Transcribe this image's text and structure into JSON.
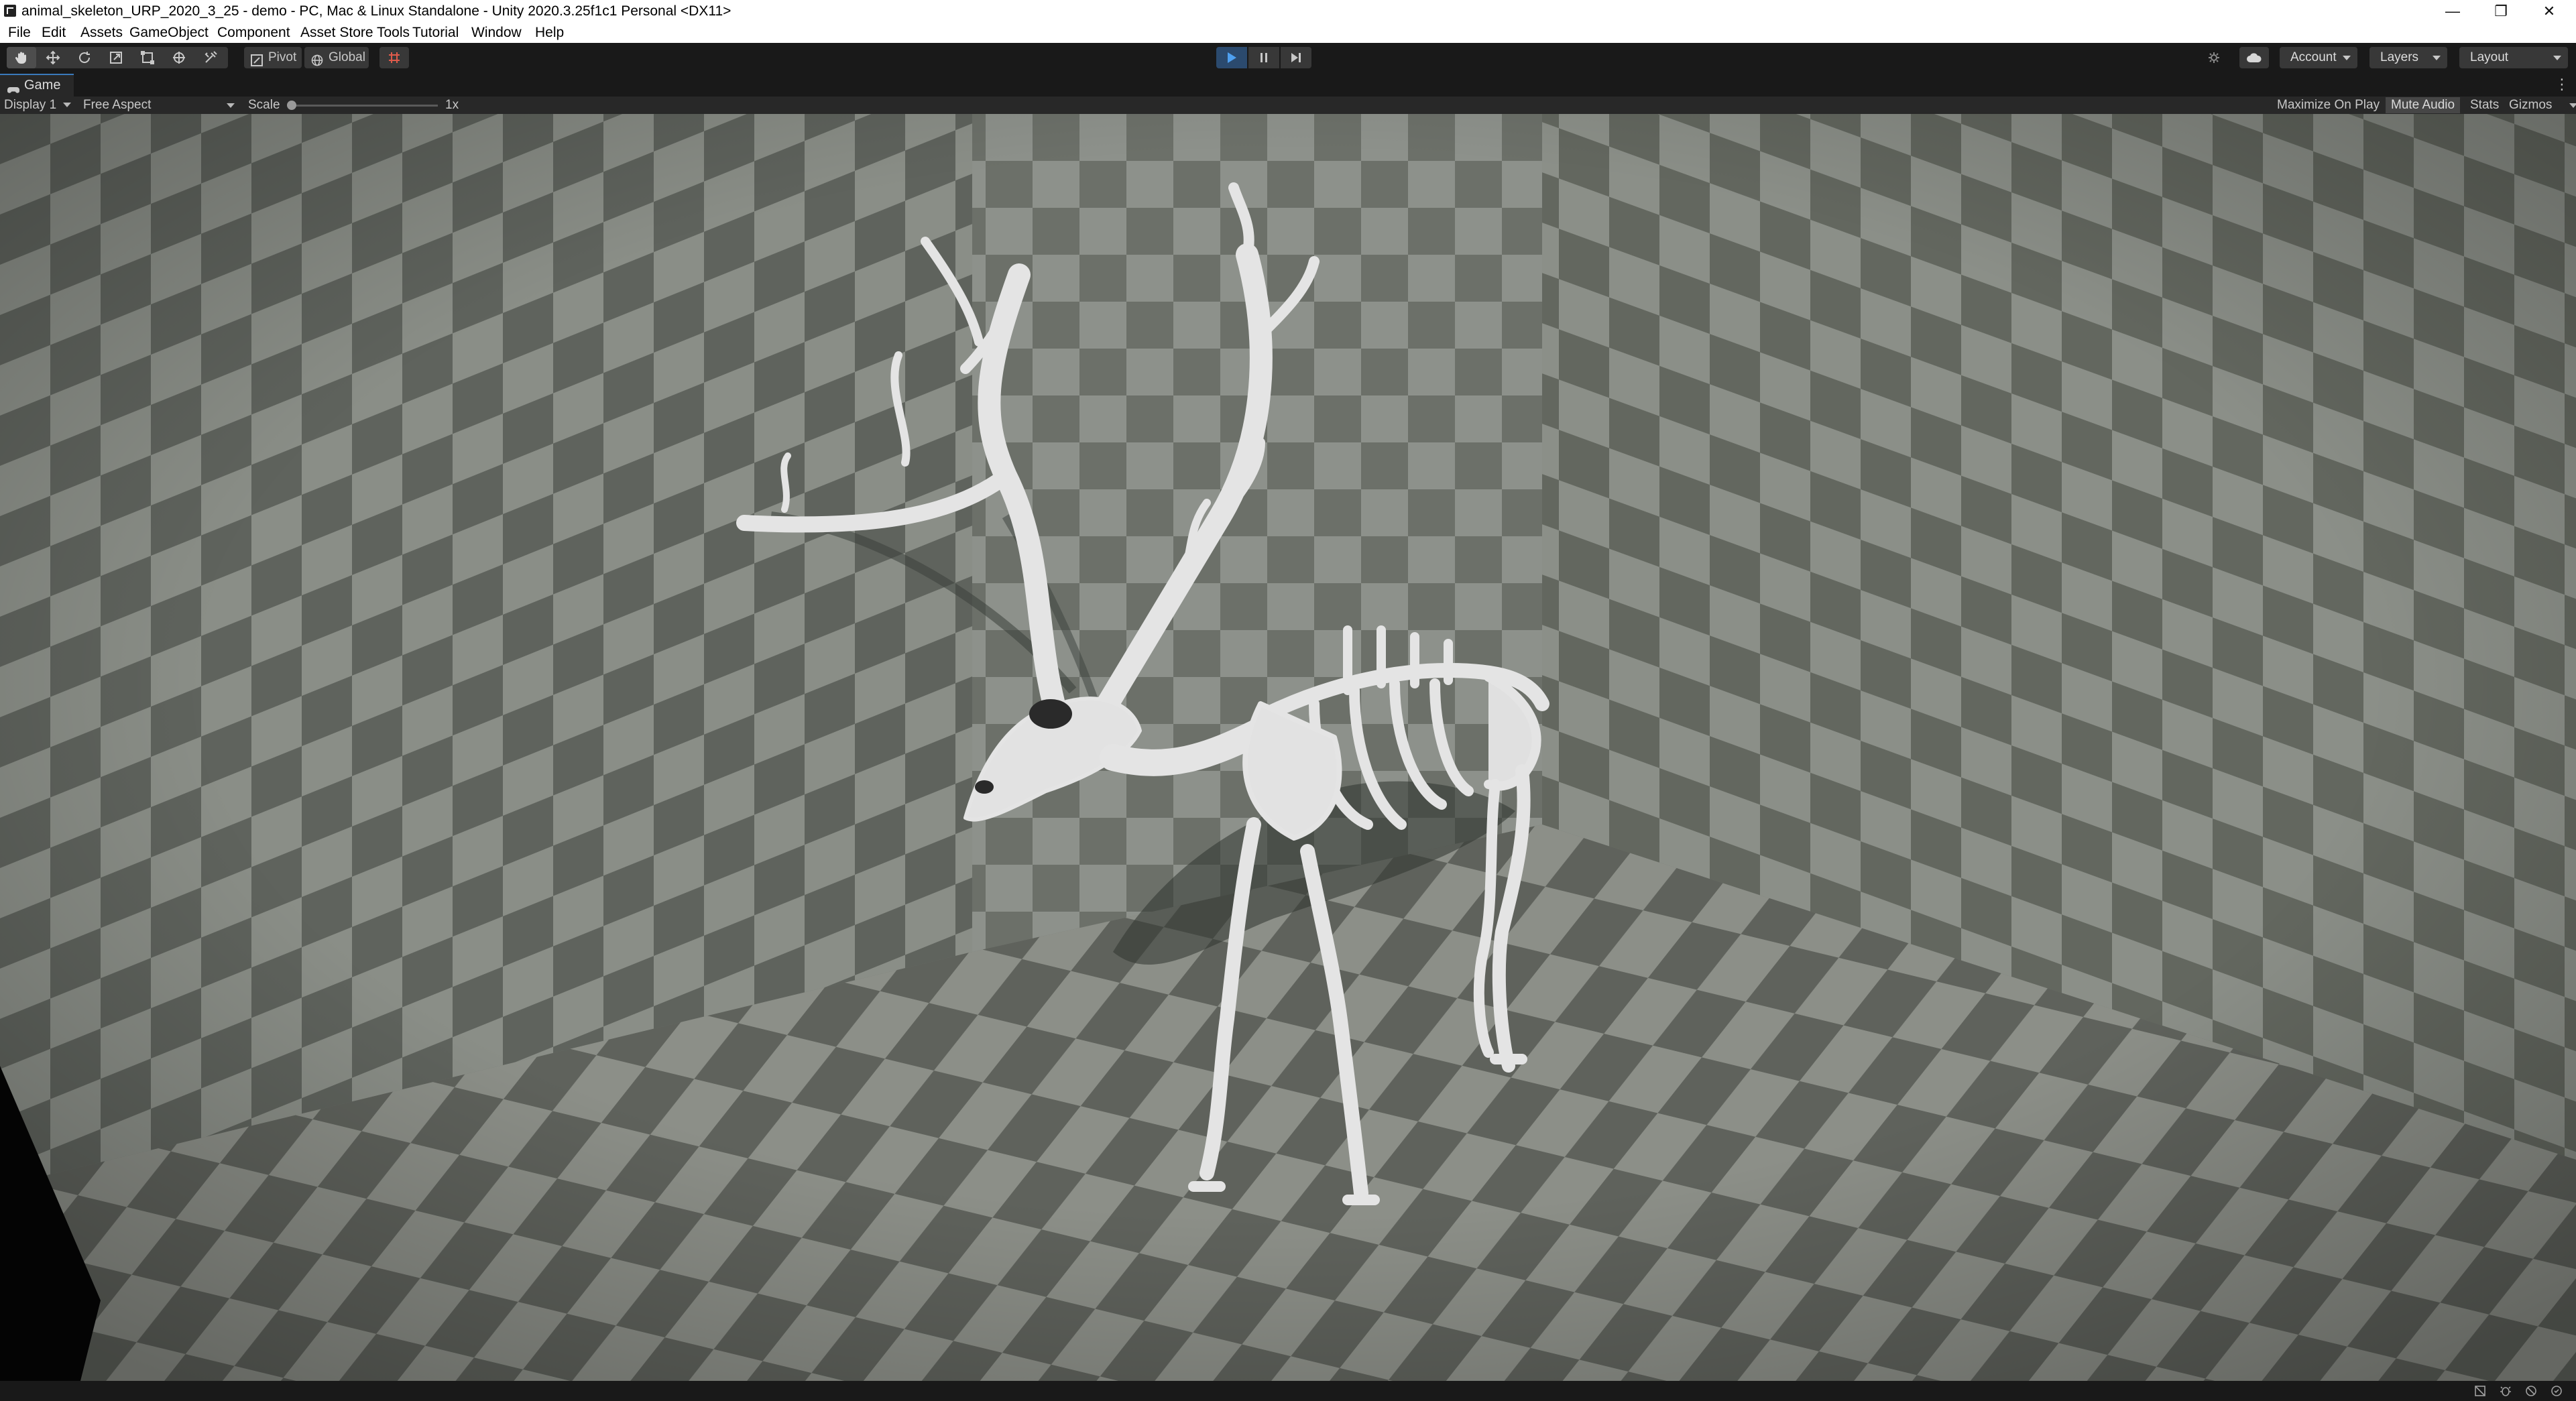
{
  "window": {
    "title": "animal_skeleton_URP_2020_3_25 - demo - PC, Mac & Linux Standalone - Unity 2020.3.25f1c1 Personal <DX11>",
    "controls": {
      "minimize": "—",
      "restore": "❐",
      "close": "✕"
    }
  },
  "menu": [
    "File",
    "Edit",
    "Assets",
    "GameObject",
    "Component",
    "Asset Store Tools",
    "Tutorial",
    "Window",
    "Help"
  ],
  "toolbar": {
    "tools": [
      "hand-icon",
      "move-icon",
      "rotate-icon",
      "scale-icon",
      "rect-icon",
      "transform-icon",
      "custom-tool-icon"
    ],
    "pivot_label": "Pivot",
    "global_label": "Global",
    "snap_icon": "grid-snap-icon",
    "play_state": "playing",
    "account_label": "Account",
    "layers_label": "Layers",
    "layout_label": "Layout",
    "accent_color": "#2b4a6e"
  },
  "game_tab": {
    "label": "Game",
    "menu_glyph": "⋮"
  },
  "game_bar": {
    "display_label": "Display 1",
    "aspect_label": "Free Aspect",
    "scale_label": "Scale",
    "scale_value": "1x",
    "scale_slider_level": 0,
    "maximize_label": "Maximize On Play",
    "mute_label": "Mute Audio",
    "stats_label": "Stats",
    "gizmos_label": "Gizmos"
  },
  "viewport": {
    "scene": "checkerboard room with a white deer skeleton",
    "floor_colors": [
      "#8c8f88",
      "#5f625c"
    ],
    "wall_colors": [
      "#8d918b",
      "#6c7069"
    ],
    "bone_color": "#e4e4e4"
  },
  "status_icons": [
    "collab-icon",
    "bug-icon",
    "cache-icon",
    "sync-icon"
  ]
}
